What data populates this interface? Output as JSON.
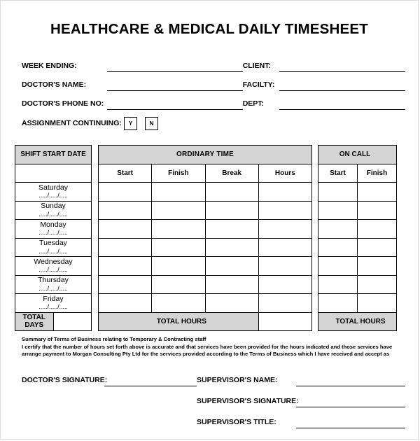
{
  "document": {
    "title": "HEALTHCARE & MEDICAL DAILY TIMESHEET"
  },
  "header_fields": {
    "left": [
      {
        "label": "WEEK ENDING:"
      },
      {
        "label": "DOCTOR'S NAME:"
      },
      {
        "label": "DOCTOR'S PHONE NO:"
      }
    ],
    "right": [
      {
        "label": "CLIENT:"
      },
      {
        "label": "FACILTY:"
      },
      {
        "label": "DEPT:"
      }
    ],
    "assignment": {
      "label": "ASSIGNMENT CONTINUING:",
      "yes": "Y",
      "no": "N"
    }
  },
  "table": {
    "date_header": "SHIFT START DATE",
    "ordinary_header": "ORDINARY TIME",
    "oncall_header": "ON CALL",
    "ordinary_columns": [
      "Start",
      "Finish",
      "Break",
      "Hours"
    ],
    "oncall_columns": [
      "Start",
      "Finish"
    ],
    "date_placeholder": "...../...../.....",
    "days": [
      "Saturday",
      "Sunday",
      "Monday",
      "Tuesday",
      "Wednesday",
      "Thursday",
      "Friday"
    ],
    "footer": {
      "total_days": "TOTAL DAYS",
      "total_hours_ordinary": "TOTAL HOURS",
      "total_hours_oncall": "TOTAL HOURS"
    }
  },
  "terms": {
    "heading": "Summary of Terms of Business relating to Temporary & Contracting staff",
    "line1": "I certify that the number of hours set forth above is accurate and that services have been provided for the hours indicated and those services have",
    "line2": "arrange payment to Morgan Consulting Pty Ltd for the services provided according to the Terms of Business which I have received and accept as"
  },
  "signatures": {
    "doctor_signature": "DOCTOR'S SIGNATURE:",
    "supervisor_name": "SUPERVISOR'S NAME:",
    "supervisor_signature": "SUPERVISOR'S SIGNATURE:",
    "supervisor_title": "SUPERVISOR'S TITLE:"
  },
  "colors": {
    "shade": "#d4d4d4",
    "border": "#000000",
    "page_border": "#dcdcdc"
  }
}
